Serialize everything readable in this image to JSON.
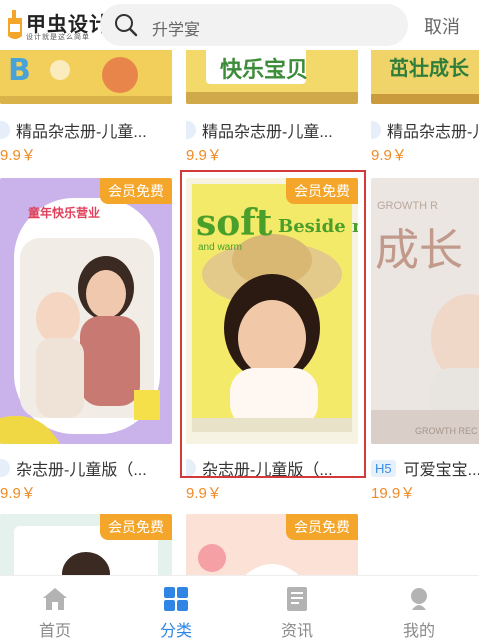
{
  "header": {
    "logo_text": "甲虫设计",
    "logo_sub": "设计就是这么简单",
    "search_text": "升学宴",
    "cancel_label": "取消"
  },
  "badge_label": "会员免费",
  "cards": [
    {
      "title": "精品杂志册-儿童...",
      "price": "9.9￥",
      "tag": ""
    },
    {
      "title": "精品杂志册-儿童...",
      "price": "9.9￥",
      "tag": ""
    },
    {
      "title": "精品杂志册-儿童...",
      "price": "9.9￥",
      "tag": ""
    },
    {
      "title": "杂志册-儿童版（...",
      "price": "9.9￥",
      "tag": ""
    },
    {
      "title": "杂志册-儿童版（...",
      "price": "9.9￥",
      "tag": ""
    },
    {
      "title": "可爱宝宝...",
      "price": "19.9￥",
      "tag": "H5"
    }
  ],
  "thumbs": {
    "top_middle_text": "快乐宝贝",
    "top_right_text": "茁壮成长",
    "card4_title": "童年快乐营业",
    "card5_headline_a": "soft",
    "card5_headline_b": "Beside me",
    "card5_sub": "and warm",
    "card6_big": "成长",
    "card6_top": "GROWTH R",
    "card6_bottom": "GROWTH REC"
  },
  "tabs": [
    {
      "label": "首页",
      "icon": "home-icon",
      "active": false
    },
    {
      "label": "分类",
      "icon": "category-icon",
      "active": true
    },
    {
      "label": "资讯",
      "icon": "news-icon",
      "active": false
    },
    {
      "label": "我的",
      "icon": "profile-icon",
      "active": false
    }
  ],
  "colors": {
    "accent": "#2f84e4",
    "price": "#f08a24",
    "badge": "#f4a62a",
    "selected_border": "#d23a3a"
  }
}
